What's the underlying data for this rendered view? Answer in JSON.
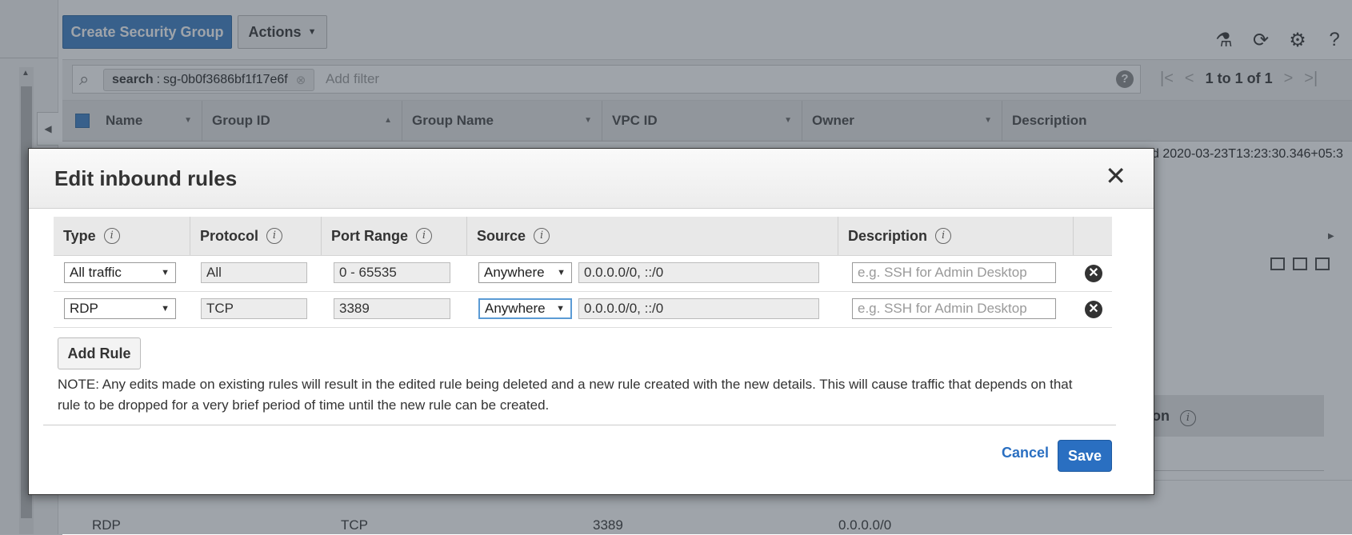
{
  "console": {
    "create_button": "Create Security Group",
    "actions_button": "Actions",
    "top_icons": [
      "flask-icon",
      "refresh-icon",
      "gear-icon",
      "help-icon"
    ],
    "filter": {
      "chip_key": "search",
      "chip_value": "sg-0b0f3686bf1f17e6f",
      "placeholder": "Add filter"
    },
    "pagination": "1 to 1 of 1",
    "columns": [
      "Name",
      "Group ID",
      "Group Name",
      "VPC ID",
      "Owner",
      "Description"
    ],
    "row_description_fragment": "d 2020-03-23T13:23:30.346+05:3",
    "lower_panel_fragment": "on",
    "lower_row": {
      "type": "RDP",
      "protocol": "TCP",
      "port_range": "3389",
      "source": "0.0.0.0/0"
    }
  },
  "modal": {
    "title": "Edit inbound rules",
    "columns": {
      "type": "Type",
      "protocol": "Protocol",
      "port_range": "Port Range",
      "source": "Source",
      "description": "Description"
    },
    "rules": [
      {
        "type": "All traffic",
        "protocol": "All",
        "port_range": "0 - 65535",
        "source_type": "Anywhere",
        "source_cidr": "0.0.0.0/0, ::/0",
        "description_placeholder": "e.g. SSH for Admin Desktop"
      },
      {
        "type": "RDP",
        "protocol": "TCP",
        "port_range": "3389",
        "source_type": "Anywhere",
        "source_cidr": "0.0.0.0/0, ::/0",
        "description_placeholder": "e.g. SSH for Admin Desktop"
      }
    ],
    "add_rule_button": "Add Rule",
    "note": "NOTE: Any edits made on existing rules will result in the edited rule being deleted and a new rule created with the new details. This will cause traffic that depends on that rule to be dropped for a very brief period of time until the new rule can be created.",
    "cancel_button": "Cancel",
    "save_button": "Save"
  },
  "colors": {
    "primary": "#2a6fc1",
    "create_button": "#3b7dc4",
    "overlay": "rgba(55,65,78,0.48)"
  }
}
